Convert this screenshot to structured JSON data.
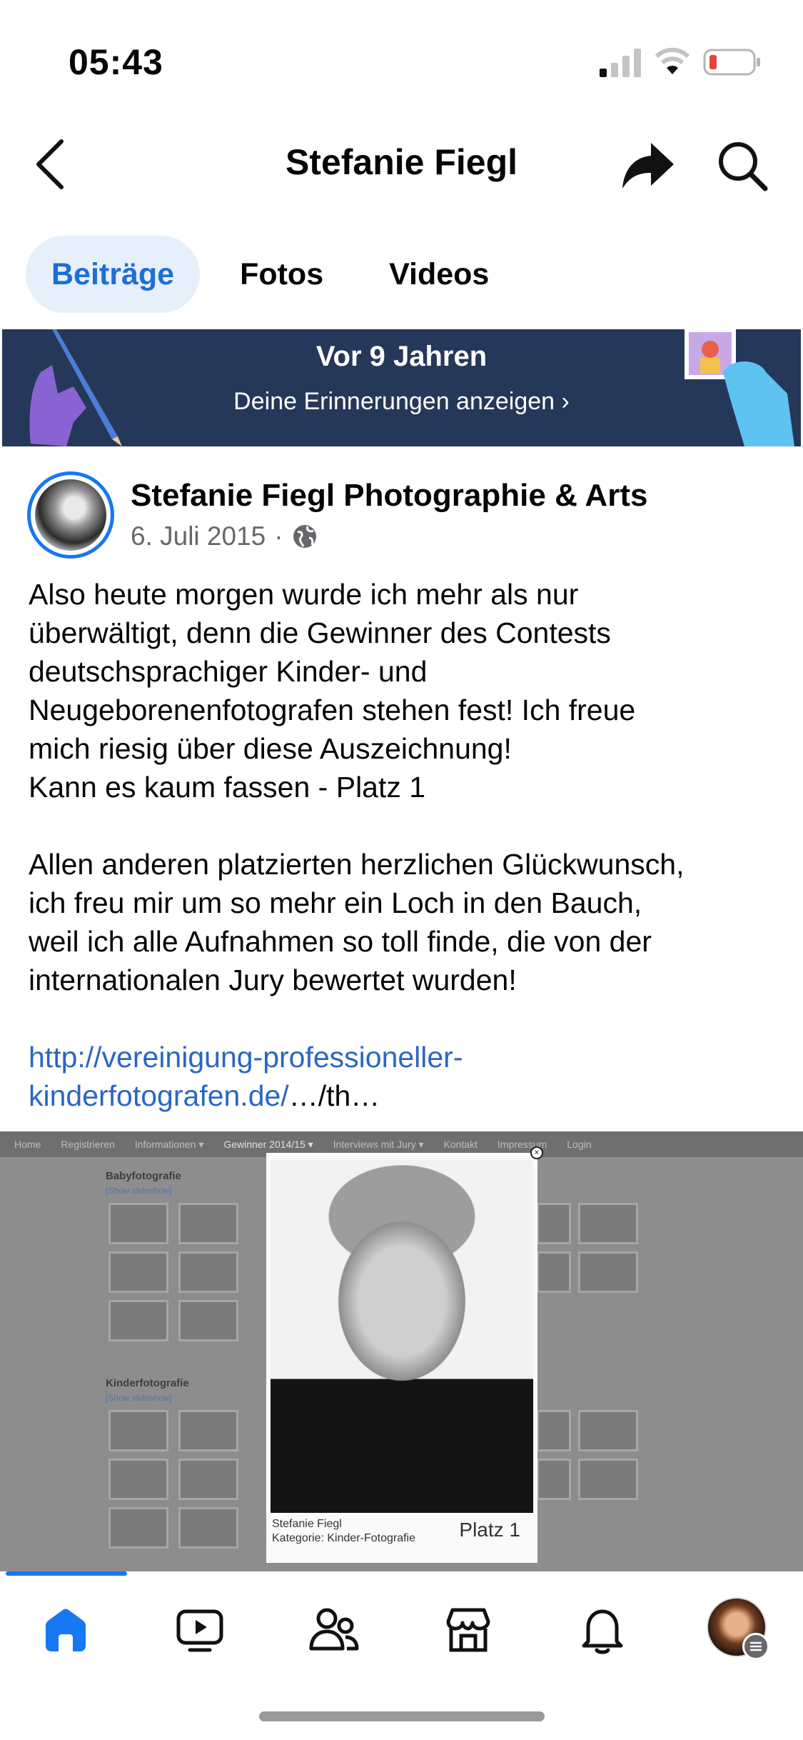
{
  "status_bar": {
    "time": "05:43"
  },
  "header": {
    "title": "Stefanie Fiegl"
  },
  "tabs": [
    {
      "label": "Beiträge",
      "active": true
    },
    {
      "label": "Fotos",
      "active": false
    },
    {
      "label": "Videos",
      "active": false
    }
  ],
  "memories": {
    "title": "Vor 9 Jahren",
    "link": "Deine Erinnerungen anzeigen ›"
  },
  "post": {
    "author": "Stefanie Fiegl Photographie & Arts",
    "date": "6. Juli 2015",
    "separator": "·",
    "text_lines": [
      "Also heute morgen wurde ich mehr als nur",
      "überwältigt, denn die Gewinner des Contests",
      "deutschsprachiger Kinder- und",
      "Neugeborenenfotografen stehen fest! Ich freue",
      "mich riesig über diese Auszeichnung!",
      "Kann es kaum fassen - Platz 1",
      "",
      "Allen anderen platzierten herzlichen Glückwunsch,",
      "ich freu mir um so mehr ein Loch in den Bauch,",
      "weil ich alle Aufnahmen so toll finde, die von der",
      "internationalen Jury bewertet wurden!",
      ""
    ],
    "link_part1": "http://vereinigung-professioneller-",
    "link_part2": "kinderfotografen.de/",
    "link_suffix": "…/th…"
  },
  "embedded_image": {
    "nav_items": [
      "Home",
      "Registrieren",
      "Informationen ▾",
      "Gewinner 2014/15 ▾",
      "Interviews mit Jury ▾",
      "Kontakt",
      "Impressum",
      "Login"
    ],
    "section1": "Babyfotografie",
    "section2": "Kinderfotografie",
    "slideshow_label": "[Show slideshow]",
    "caption_line1": "Stefanie Fiegl",
    "caption_line2": "Kategorie: Kinder-Fotografie",
    "place": "Platz 1",
    "close": "×"
  },
  "colors": {
    "accent": "#1877f2",
    "banner_bg": "#263859",
    "tab_active_bg": "#e6f0fb",
    "link": "#2a66c5"
  },
  "tabbar": {
    "items": [
      "home-icon",
      "video-icon",
      "friends-icon",
      "marketplace-icon",
      "bell-icon",
      "profile-avatar"
    ]
  }
}
